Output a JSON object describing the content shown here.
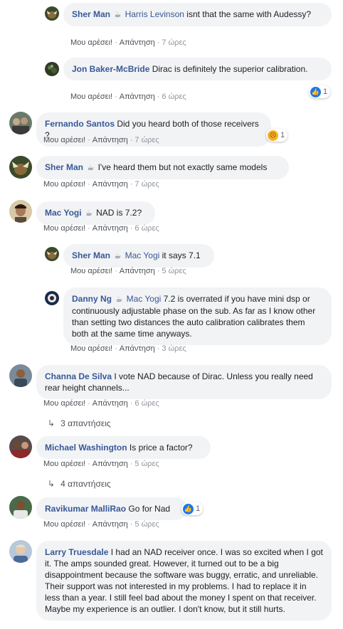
{
  "actions": {
    "like": "Μου αρέσει!",
    "reply": "Απάντηση"
  },
  "badge_icon": "coffee-cup-icon",
  "comments": [
    {
      "author": "Sher Man",
      "badge": "☕",
      "tag": "Harris Levinson",
      "text": " isnt that the same with Audessy?",
      "time": "7 ώρες"
    },
    {
      "author": "Jon Baker-McBride",
      "text": " Dirac is definitely the superior calibration.",
      "time": "6 ώρες",
      "reaction_count": "1"
    },
    {
      "author": "Fernando Santos",
      "text": " Did you heard both of those receivers ?",
      "time": "7 ώρες",
      "reaction_count": "1"
    },
    {
      "author": "Sher Man",
      "badge": "☕",
      "text": " I've heard them but not exactly same models",
      "time": "7 ώρες"
    },
    {
      "author": "Mac Yogi",
      "badge": "☕",
      "text": " NAD is 7.2?",
      "time": "6 ώρες"
    },
    {
      "author": "Sher Man",
      "badge": "☕",
      "tag": "Mac Yogi",
      "text": " it says 7.1",
      "time": "5 ώρες"
    },
    {
      "author": "Danny Ng",
      "badge": "☕",
      "tag": "Mac Yogi",
      "text": " 7.2 is overrated if you have mini dsp or continuously adjustable phase on the sub. As far as I know other than setting two distances the auto calibration calibrates them both at the same time anyways.",
      "time": "3 ώρες"
    },
    {
      "author": "Channa De Silva",
      "text": " I vote NAD because of Dirac. Unless you really need rear height channels...",
      "time": "6 ώρες",
      "replies": "3 απαντήσεις"
    },
    {
      "author": "Michael Washington",
      "text": " Is price a factor?",
      "time": "5 ώρες",
      "replies": "4 απαντήσεις"
    },
    {
      "author": "Ravikumar MalliRao",
      "text": " Go for Nad",
      "time": "5 ώρες",
      "reaction_count": "1"
    },
    {
      "author": "Larry Truesdale",
      "text": " I had an NAD receiver once. I was so excited when I got it. The amps sounded great. However, it turned out to be a big disappointment because the software was buggy, erratic, and unreliable. Their support was not interested in my problems. I had to replace it in less than a year. I still feel bad about the money I spent on that receiver. Maybe my experience is an outlier. I don't know, but it still hurts."
    }
  ],
  "colors": {
    "author": "#385898",
    "bubble": "#f2f3f5",
    "like": "#1877f2"
  }
}
